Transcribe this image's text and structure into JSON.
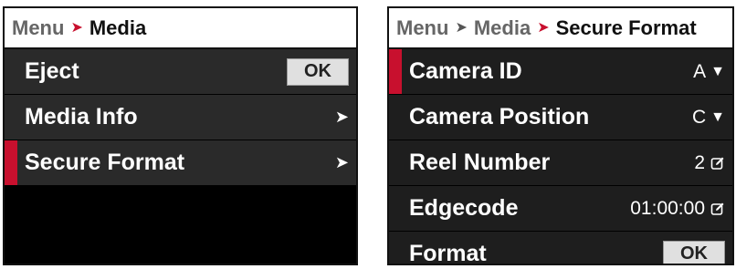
{
  "left_panel": {
    "breadcrumb": [
      {
        "label": "Menu"
      },
      {
        "label": "Media"
      }
    ],
    "items": [
      {
        "label": "Eject",
        "button": "OK"
      },
      {
        "label": "Media Info"
      },
      {
        "label": "Secure Format",
        "selected": true
      }
    ]
  },
  "right_panel": {
    "breadcrumb": [
      {
        "label": "Menu"
      },
      {
        "label": "Media"
      },
      {
        "label": "Secure Format"
      }
    ],
    "items": [
      {
        "label": "Camera ID",
        "value": "A"
      },
      {
        "label": "Camera Position",
        "value": "C"
      },
      {
        "label": "Reel Number",
        "value": "2"
      },
      {
        "label": "Edgecode",
        "value": "01:00:00"
      },
      {
        "label": "Format",
        "button": "OK"
      }
    ]
  },
  "colors": {
    "accent": "#c8102e",
    "background": "#000000",
    "row": "#2a2a2a"
  },
  "icons": {
    "chevron": "chevron-right-icon",
    "dropdown": "caret-down-icon",
    "edit": "edit-icon"
  }
}
